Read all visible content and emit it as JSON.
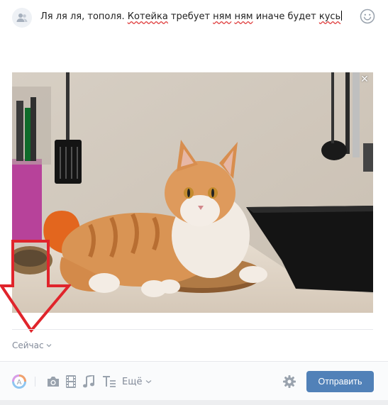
{
  "post": {
    "text_segments": [
      {
        "text": "Ля ля ля, тополя. ",
        "misspelled": false
      },
      {
        "text": "Котейка",
        "misspelled": true
      },
      {
        "text": " требует ",
        "misspelled": false
      },
      {
        "text": "ням",
        "misspelled": true
      },
      {
        "text": " ",
        "misspelled": false
      },
      {
        "text": "ням",
        "misspelled": true
      },
      {
        "text": " иначе будет ",
        "misspelled": false
      },
      {
        "text": "кусь",
        "misspelled": true
      }
    ]
  },
  "icons": {
    "audience": "people-icon",
    "emoji": "smiley-icon",
    "remove": "close-icon",
    "time_chevron": "chevron-down-icon",
    "more_chevron": "chevron-down-icon",
    "settings": "gear-icon"
  },
  "attachment": {
    "type": "photo",
    "remove_glyph": "✕"
  },
  "publish_time": {
    "label": "Сейчас"
  },
  "toolbar": {
    "items": [
      "rainbow-a-icon",
      "camera-icon",
      "film-icon",
      "music-note-icon",
      "text-format-icon"
    ],
    "more_label": "Ещё",
    "send_label": "Отправить"
  },
  "colors": {
    "accent": "#5181b8",
    "muted_text": "#828a99",
    "annotation_arrow": "#e0242b"
  }
}
